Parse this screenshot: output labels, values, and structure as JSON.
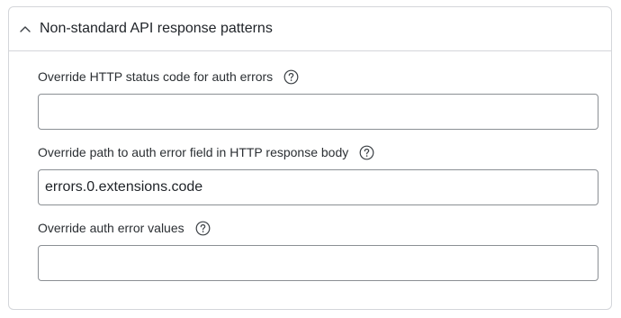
{
  "section": {
    "title": "Non-standard API response patterns",
    "expanded": true,
    "chevron_icon": "chevron-up-icon"
  },
  "fields": [
    {
      "label": "Override HTTP status code for auth errors",
      "value": "",
      "help_icon": "question-circle-icon"
    },
    {
      "label": "Override path to auth error field in HTTP response body",
      "value": "errors.0.extensions.code",
      "help_icon": "question-circle-icon"
    },
    {
      "label": "Override auth error values",
      "value": "",
      "help_icon": "question-circle-icon"
    }
  ],
  "colors": {
    "border": "#d4d6da",
    "input_border": "#8b8f94",
    "text": "#1f2328"
  }
}
